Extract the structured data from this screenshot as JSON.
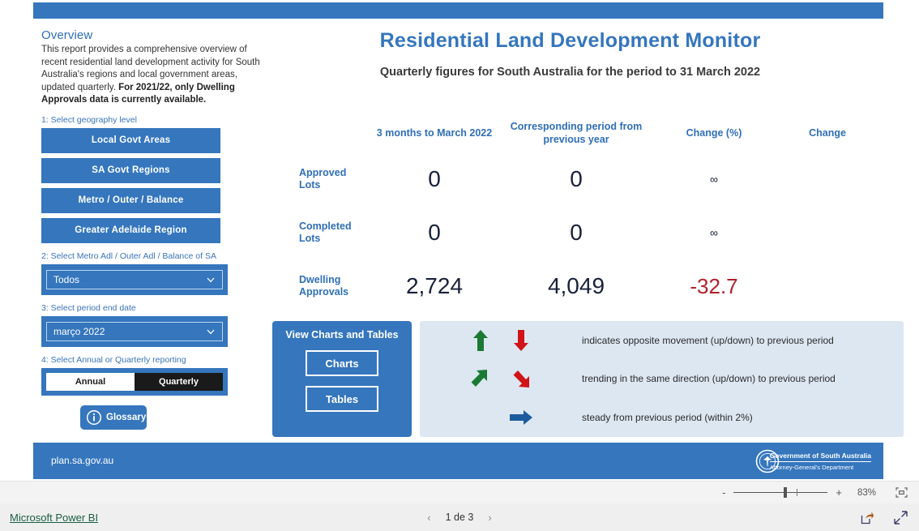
{
  "theme": {
    "brand_blue": "#3576bd",
    "title_blue": "#2f6fb5",
    "legend_bg": "#dde7f1",
    "negative_red": "#b0202b",
    "arrow_green": "#1a7a33",
    "arrow_red": "#d01417",
    "arrow_blue": "#1c5b9e"
  },
  "overview": {
    "heading": "Overview",
    "paragraph": "This report provides a comprehensive overview of recent residential land development activity for South Australia's regions and local government areas, updated quarterly.",
    "bold_note": "For 2021/22, only Dwelling Approvals data is currently available."
  },
  "controls": {
    "step1_label": "1: Select geography level",
    "geography_buttons": [
      {
        "label": "Local Govt Areas"
      },
      {
        "label": "SA Govt Regions"
      },
      {
        "label": "Metro / Outer / Balance"
      },
      {
        "label": "Greater Adelaide Region"
      }
    ],
    "step2_label": "2: Select Metro Adl / Outer Adl / Balance of SA",
    "region_dropdown_value": "Todos",
    "step3_label": "3: Select period end date",
    "period_dropdown_value": "março 2022",
    "step4_label": "4: Select Annual or Quarterly reporting",
    "reporting_options": [
      {
        "label": "Annual",
        "selected": false
      },
      {
        "label": "Quarterly",
        "selected": true
      }
    ],
    "glossary_label": "Glossary"
  },
  "report": {
    "title": "Residential Land Development Monitor",
    "subtitle": "Quarterly figures for South Australia for the period to 31 March 2022"
  },
  "table": {
    "headers": [
      "",
      "3 months to March 2022",
      "Corresponding period from previous year",
      "Change (%)",
      "Change"
    ],
    "rows": [
      {
        "label": "Approved Lots",
        "current": "0",
        "previous": "0",
        "change_pct": "∞",
        "change": "",
        "negative": false
      },
      {
        "label": "Completed Lots",
        "current": "0",
        "previous": "0",
        "change_pct": "∞",
        "change": "",
        "negative": false
      },
      {
        "label": "Dwelling Approvals",
        "current": "2,724",
        "previous": "4,049",
        "change_pct": "-32.7",
        "change": "",
        "negative": true
      }
    ]
  },
  "view_panel": {
    "title": "View Charts and Tables",
    "charts_label": "Charts",
    "tables_label": "Tables"
  },
  "legend": {
    "rows": [
      {
        "text": "indicates opposite movement (up/down) to previous period"
      },
      {
        "text": "trending in the same direction (up/down) to previous period"
      },
      {
        "text": "steady from previous period (within 2%)"
      }
    ]
  },
  "footer": {
    "url": "plan.sa.gov.au",
    "gov_line1": "Government of South Australia",
    "gov_line2": "Attorney-General's Department"
  },
  "zoombar": {
    "minus": "-",
    "plus": "+",
    "zoom_level": "83%"
  },
  "bottom": {
    "powerbi_label": "Microsoft Power BI",
    "page_indicator": "1 de 3",
    "prev": "‹",
    "next": "›"
  }
}
